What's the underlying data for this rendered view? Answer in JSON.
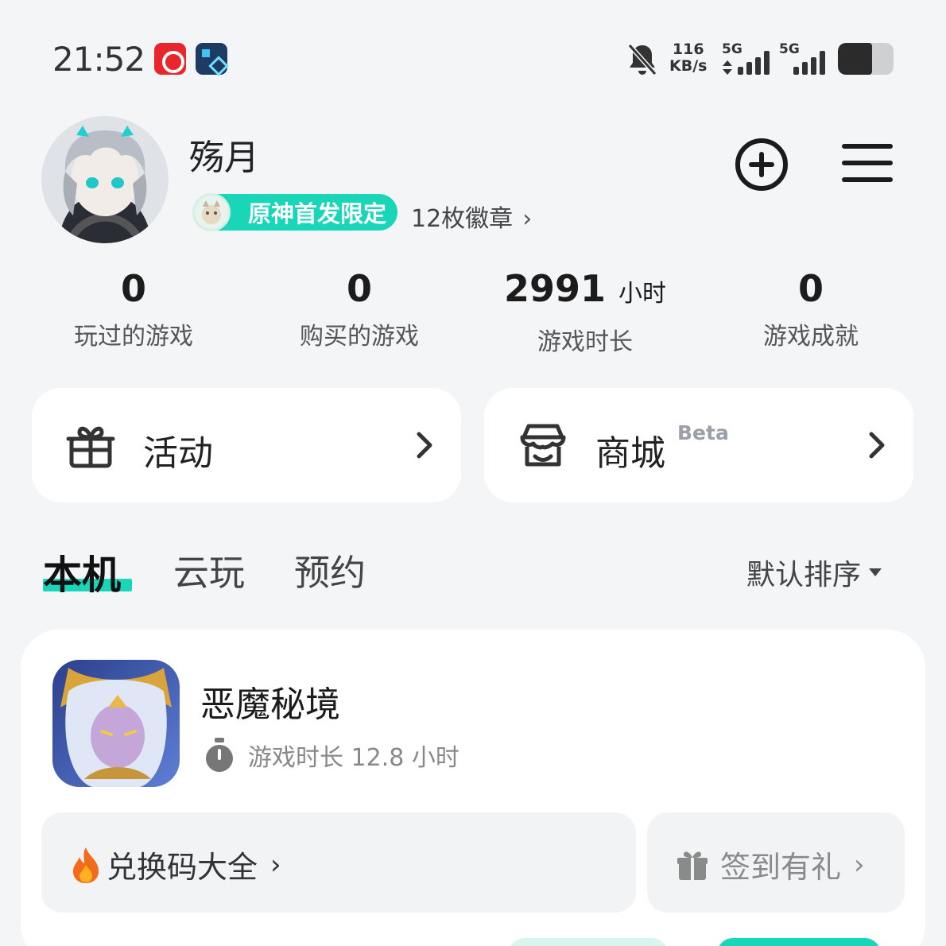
{
  "status_bar": {
    "time": "21:52",
    "apps": [
      "netease-music-icon",
      "gamer-app-icon"
    ],
    "notifications": "muted",
    "speed_value": "116",
    "speed_unit": "KB/s",
    "sim1": "5G",
    "sim2": "5G",
    "battery_level": 0.62
  },
  "profile": {
    "username": "殇月",
    "badge_label": "原神首发限定",
    "badge_count": "12枚徽章",
    "badge_chevron": "›"
  },
  "stats": [
    {
      "value": "0",
      "unit": "",
      "label": "玩过的游戏"
    },
    {
      "value": "0",
      "unit": "",
      "label": "购买的游戏"
    },
    {
      "value": "2991",
      "unit": "小时",
      "label": "游戏时长"
    },
    {
      "value": "0",
      "unit": "",
      "label": "游戏成就"
    }
  ],
  "cards": {
    "activity": {
      "label": "活动",
      "icon": "gift-icon"
    },
    "shop": {
      "label": "商城",
      "tag": "Beta",
      "icon": "shop-icon"
    }
  },
  "tabs": [
    {
      "label": "本机",
      "active": true
    },
    {
      "label": "云玩",
      "active": false
    },
    {
      "label": "预约",
      "active": false
    }
  ],
  "sort": {
    "label": "默认排序"
  },
  "game": {
    "title": "恶魔秘境",
    "playtime": "游戏时长 12.8 小时",
    "codes_label": "兑换码大全",
    "signin_label": "签到有礼",
    "chevron": "›"
  },
  "colors": {
    "accent": "#19d6b9",
    "background": "#f4f5f7",
    "card": "#ffffff"
  }
}
